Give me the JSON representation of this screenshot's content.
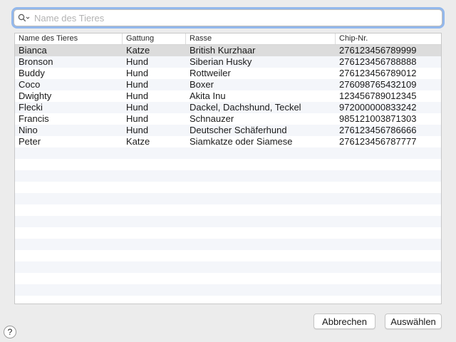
{
  "search": {
    "placeholder": "Name des Tieres",
    "value": ""
  },
  "table": {
    "columns": [
      "Name des Tieres",
      "Gattung",
      "Rasse",
      "Chip-Nr."
    ],
    "rows": [
      [
        "Bianca",
        "Katze",
        "British Kurzhaar",
        "276123456789999"
      ],
      [
        "Bronson",
        "Hund",
        "Siberian Husky",
        "276123456788888"
      ],
      [
        "Buddy",
        "Hund",
        "Rottweiler",
        "276123456789012"
      ],
      [
        "Coco",
        "Hund",
        "Boxer",
        "276098765432109"
      ],
      [
        "Dwighty",
        "Hund",
        "Akita Inu",
        "123456789012345"
      ],
      [
        "Flecki",
        "Hund",
        "Dackel, Dachshund, Teckel",
        "972000000833242"
      ],
      [
        "Francis",
        "Hund",
        "Schnauzer",
        "985121003871303"
      ],
      [
        "Nino",
        "Hund",
        "Deutscher Schäferhund",
        "276123456786666"
      ],
      [
        "Peter",
        "Katze",
        "Siamkatze oder Siamese",
        "276123456787777"
      ]
    ],
    "selected_row": 0
  },
  "buttons": {
    "cancel": "Abbrechen",
    "select": "Auswählen"
  },
  "help": {
    "label": "?"
  },
  "colors": {
    "focus_ring": "#93b8ec",
    "stripe": "#f4f6fa",
    "selection": "#dcdcdc"
  }
}
